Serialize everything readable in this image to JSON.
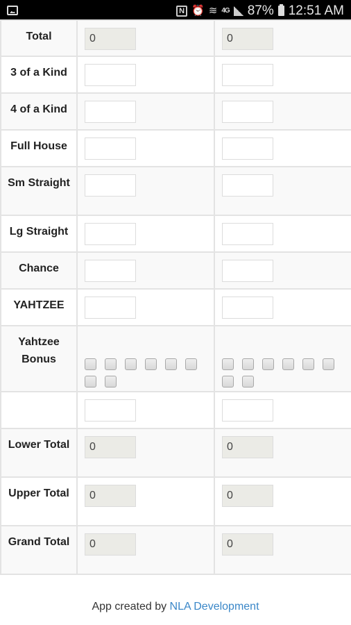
{
  "status_bar": {
    "battery": "87%",
    "time": "12:51 AM",
    "network": "4G"
  },
  "rows": [
    {
      "label": "Total",
      "type": "readonly",
      "p1": "0",
      "p2": "0"
    },
    {
      "label": "3 of a Kind",
      "type": "input",
      "p1": "",
      "p2": ""
    },
    {
      "label": "4 of a Kind",
      "type": "input",
      "p1": "",
      "p2": ""
    },
    {
      "label": "Full House",
      "type": "input",
      "p1": "",
      "p2": ""
    },
    {
      "label": "Sm Straight",
      "type": "input",
      "p1": "",
      "p2": ""
    },
    {
      "label": "Lg Straight",
      "type": "input",
      "p1": "",
      "p2": ""
    },
    {
      "label": "Chance",
      "type": "input",
      "p1": "",
      "p2": ""
    },
    {
      "label": "YAHTZEE",
      "type": "input",
      "p1": "",
      "p2": ""
    },
    {
      "label": "Yahtzee Bonus",
      "type": "checkboxes",
      "count": 8
    },
    {
      "label": "",
      "type": "input",
      "p1": "",
      "p2": ""
    },
    {
      "label": "Lower Total",
      "type": "readonly",
      "p1": "0",
      "p2": "0"
    },
    {
      "label": "Upper Total",
      "type": "readonly",
      "p1": "0",
      "p2": "0"
    },
    {
      "label": "Grand Total",
      "type": "readonly",
      "p1": "0",
      "p2": "0"
    }
  ],
  "footer": {
    "prefix": "App created by ",
    "link_text": "NLA Development",
    "link_color": "#3a87c8"
  }
}
